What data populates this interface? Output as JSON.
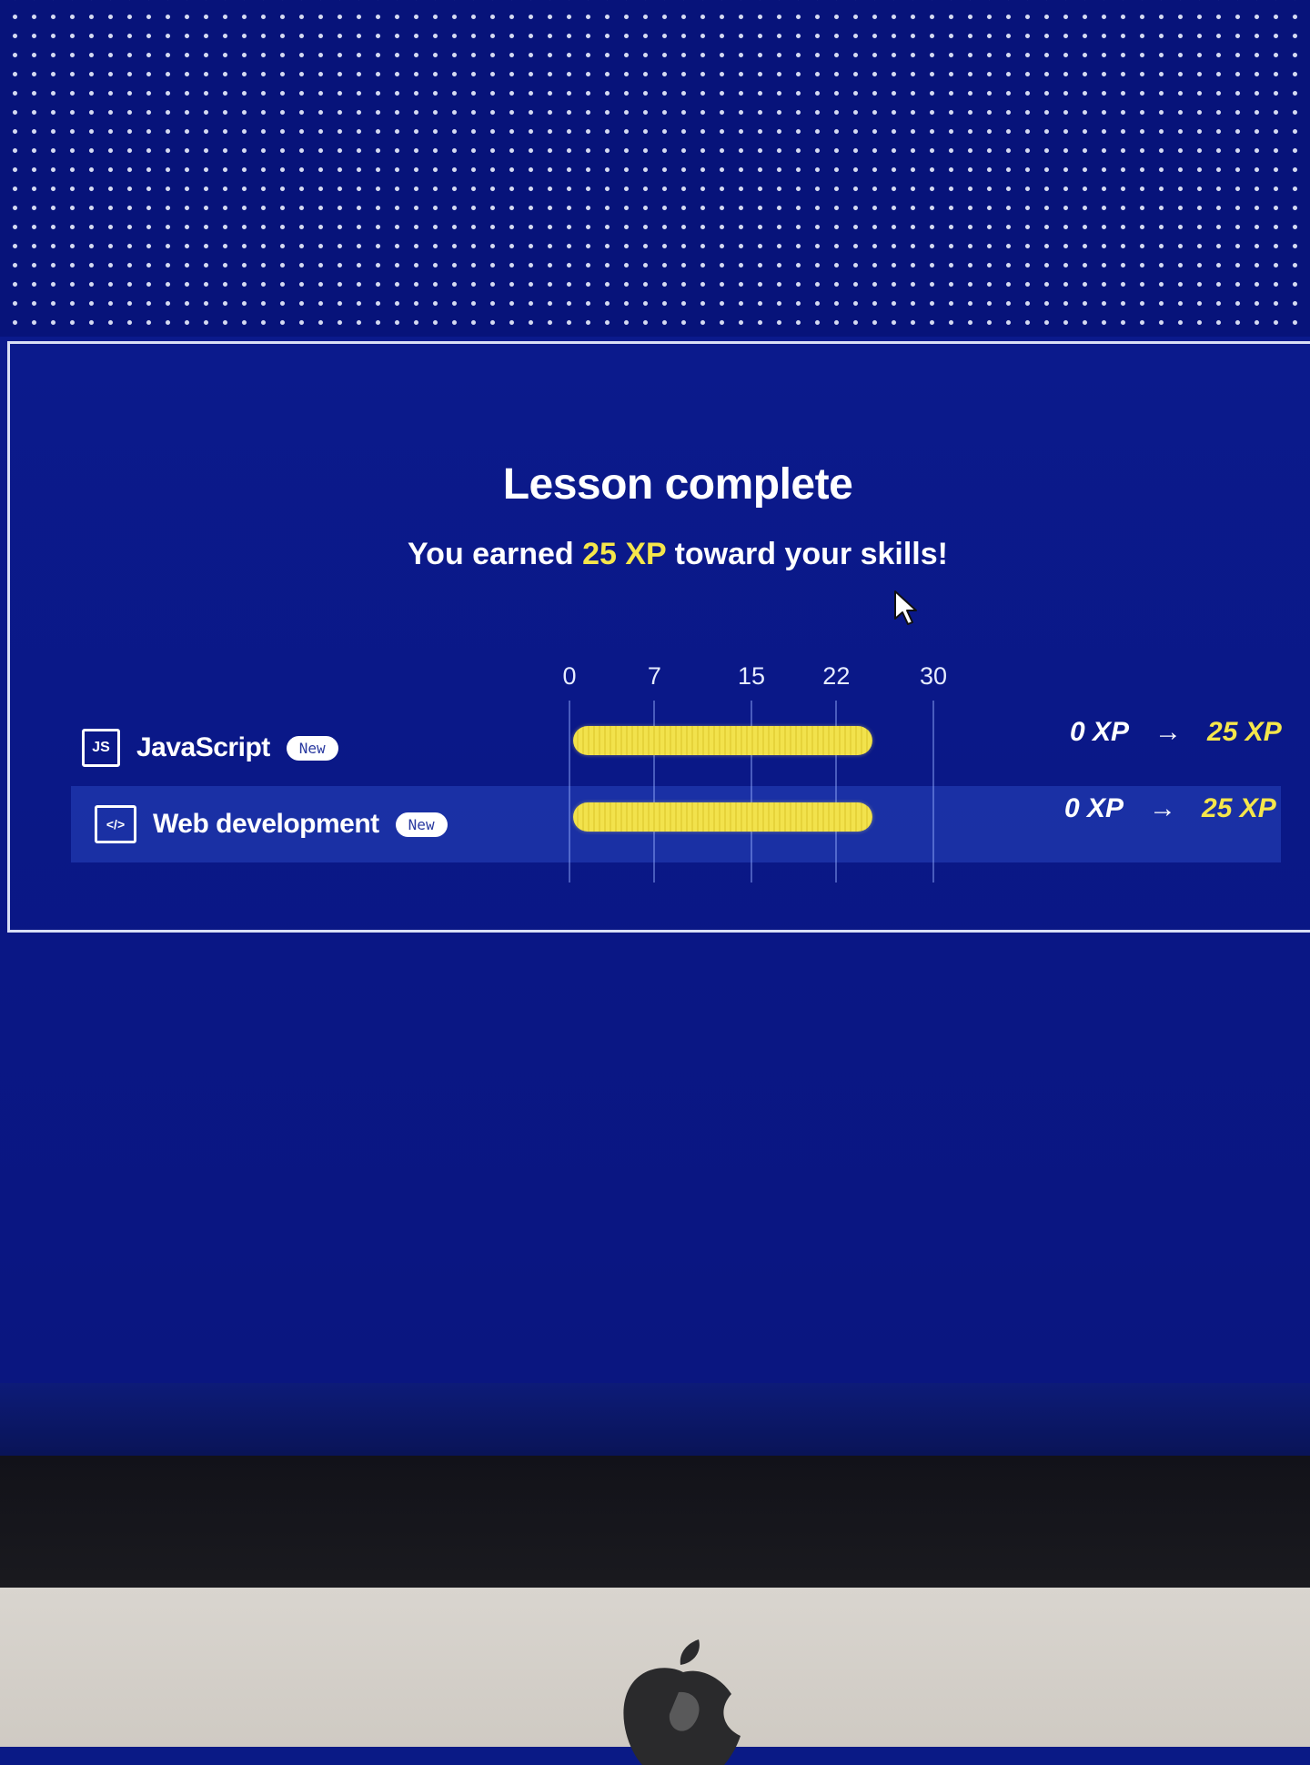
{
  "lesson": {
    "title": "Lesson complete",
    "subtitle_prefix": "You earned ",
    "subtitle_xp": "25 XP",
    "subtitle_suffix": " toward your skills!"
  },
  "chart_data": {
    "type": "bar",
    "orientation": "horizontal",
    "ticks": [
      "0",
      "7",
      "15",
      "22",
      "30"
    ],
    "xlim": [
      0,
      30
    ],
    "categories": [
      "JavaScript",
      "Web development"
    ],
    "series": [
      {
        "values": [
          25,
          25
        ]
      }
    ],
    "bar_color": "#f2e24c"
  },
  "skills": [
    {
      "icon": "js-icon",
      "icon_text": "JS",
      "name": "JavaScript",
      "badge": "New",
      "xp_from": "0 XP",
      "xp_arrow": "→",
      "xp_to": "25 XP"
    },
    {
      "icon": "code-window-icon",
      "icon_text": "</>",
      "name": "Web development",
      "badge": "New",
      "xp_from": "0 XP",
      "xp_arrow": "→",
      "xp_to": "25 XP"
    }
  ],
  "colors": {
    "background": "#0a1a86",
    "accent_xp": "#f5e64b",
    "panel_border": "#d8def5"
  }
}
